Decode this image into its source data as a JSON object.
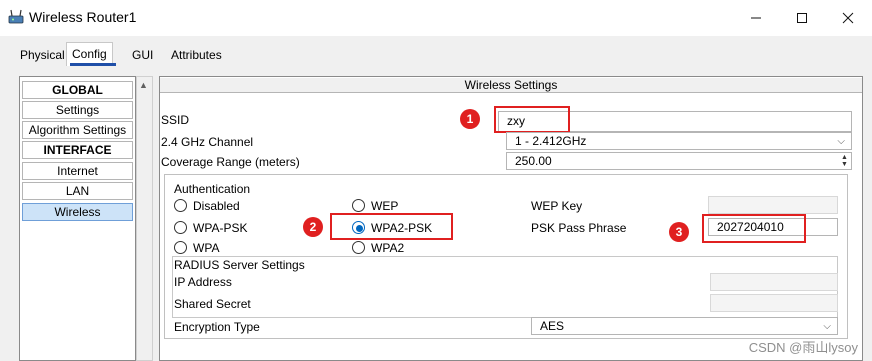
{
  "window": {
    "title": "Wireless Router1",
    "minimize_icon": "minimize-icon",
    "maximize_icon": "maximize-icon",
    "close_icon": "close-icon"
  },
  "tabs": [
    {
      "label": "Physical",
      "active": false
    },
    {
      "label": "Config",
      "active": true
    },
    {
      "label": "GUI",
      "active": false
    },
    {
      "label": "Attributes",
      "active": false
    }
  ],
  "sidebar": {
    "items": [
      {
        "label": "GLOBAL",
        "header": true
      },
      {
        "label": "Settings",
        "header": false
      },
      {
        "label": "Algorithm Settings",
        "header": false
      },
      {
        "label": "INTERFACE",
        "header": true
      },
      {
        "label": "Internet",
        "header": false
      },
      {
        "label": "LAN",
        "header": false
      },
      {
        "label": "Wireless",
        "header": false,
        "selected": true
      }
    ]
  },
  "main": {
    "title": "Wireless Settings",
    "ssid_label": "SSID",
    "ssid_value": "zxy",
    "channel_label": "2.4 GHz Channel",
    "channel_value": "1 - 2.412GHz",
    "coverage_label": "Coverage Range (meters)",
    "coverage_value": "250.00"
  },
  "auth": {
    "title": "Authentication",
    "options": {
      "disabled": "Disabled",
      "wep": "WEP",
      "wpa_psk": "WPA-PSK",
      "wpa2_psk": "WPA2-PSK",
      "wpa": "WPA",
      "wpa2": "WPA2"
    },
    "selected": "WPA2-PSK",
    "wep_key_label": "WEP Key",
    "psk_label": "PSK Pass Phrase",
    "psk_value": "2027204010",
    "radius_title": "RADIUS Server Settings",
    "ip_label": "IP Address",
    "secret_label": "Shared Secret",
    "encryption_label": "Encryption Type",
    "encryption_value": "AES"
  },
  "annotations": [
    "1",
    "2",
    "3"
  ],
  "watermark": "CSDN @雨山lysoy",
  "colors": {
    "accent": "#0067c0",
    "annotation": "#e02020",
    "selected_nav": "#cde3f8"
  }
}
